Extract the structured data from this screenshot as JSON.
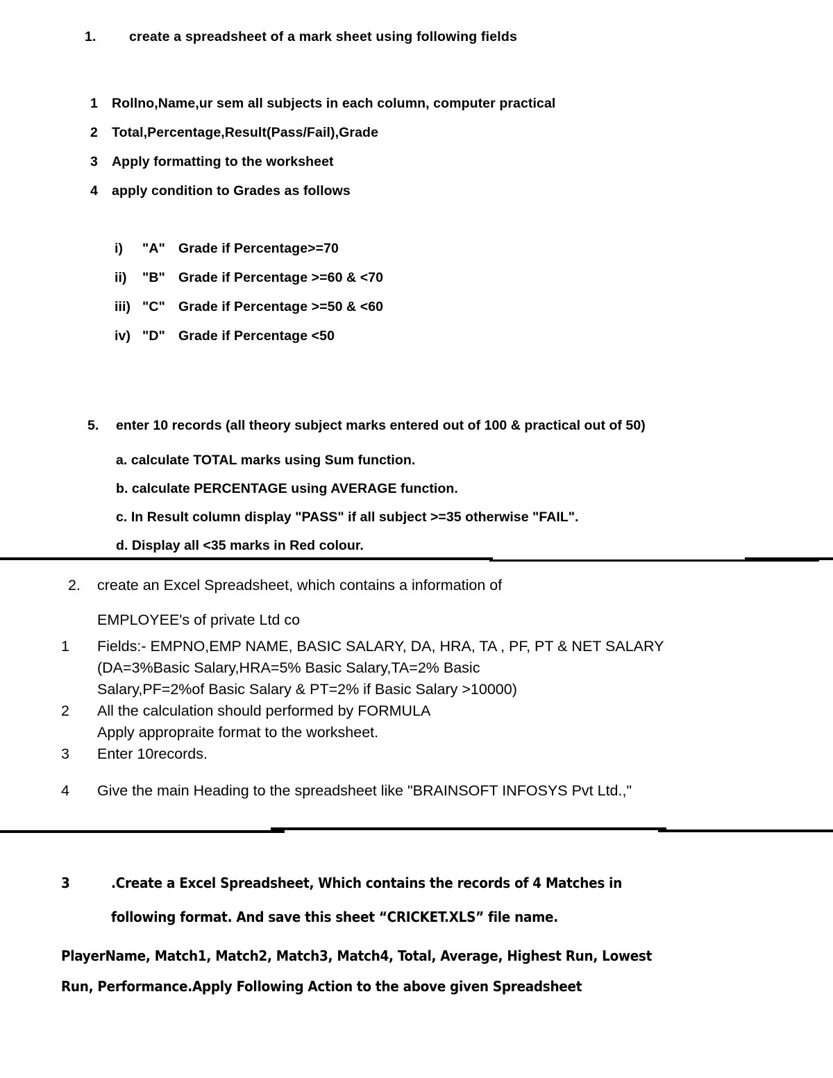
{
  "document": {
    "section1": {
      "number": "1.",
      "title": "create a spreadsheet of a mark sheet using following fields",
      "fields": [
        {
          "marker": "1",
          "text": "Rollno,Name,ur sem all subjects in each column, computer practical"
        },
        {
          "marker": "2",
          "text": "Total,Percentage,Result(Pass/Fail),Grade"
        },
        {
          "marker": "3",
          "text": "Apply formatting to the worksheet"
        },
        {
          "marker": "4",
          "text": "apply condition to Grades as follows"
        }
      ],
      "grades": [
        {
          "roman": "i)",
          "grade": "\"A\"",
          "condition": "Grade if Percentage>=70"
        },
        {
          "roman": "ii)",
          "grade": "\"B\"",
          "condition": "Grade if Percentage >=60 & <70"
        },
        {
          "roman": "iii)",
          "grade": "\"C\"",
          "condition": "Grade if Percentage >=50 & <60"
        },
        {
          "roman": "iv)",
          "grade": "\"D\"",
          "condition": "Grade if Percentage <50"
        }
      ],
      "item5": {
        "number": "5.",
        "text": "enter 10 records (all theory subject marks entered out of 100 & practical out of 50)",
        "subitems": [
          "a. calculate TOTAL marks using Sum function.",
          "b. calculate PERCENTAGE using AVERAGE function.",
          "c. In Result column display \"PASS\" if all subject >=35 otherwise \"FAIL\".",
          "d. Display all <35 marks in Red colour."
        ]
      }
    },
    "section2": {
      "number": "2.",
      "title": "create an Excel Spreadsheet, which contains a information of",
      "subtitle": "EMPLOYEE's of private Ltd co",
      "items": [
        {
          "marker": "1",
          "lines": [
            "Fields:- EMPNO,EMP NAME, BASIC SALARY, DA, HRA, TA , PF, PT & NET SALARY",
            "(DA=3%Basic Salary,HRA=5% Basic Salary,TA=2% Basic",
            "Salary,PF=2%of Basic Salary & PT=2% if Basic Salary >10000)"
          ]
        },
        {
          "marker": "2",
          "lines": [
            "All the calculation should performed by FORMULA",
            "Apply appropraite format to the worksheet."
          ]
        },
        {
          "marker": "3",
          "lines": [
            "Enter 10records."
          ]
        },
        {
          "marker": "4",
          "lines": [
            "Give the main Heading to the spreadsheet like \"BRAINSOFT INFOSYS Pvt Ltd.,\""
          ]
        }
      ]
    },
    "section3": {
      "number": "3",
      "line1": ".Create a Excel Spreadsheet, Which contains the records of 4 Matches in",
      "line2": "following format. And save this sheet “CRICKET.XLS” file name.",
      "paragraph_line1": "PlayerName, Match1, Match2, Match3, Match4, Total, Average, Highest Run, Lowest",
      "paragraph_line2": "Run, Performance.Apply Following Action to the above given Spreadsheet"
    }
  }
}
